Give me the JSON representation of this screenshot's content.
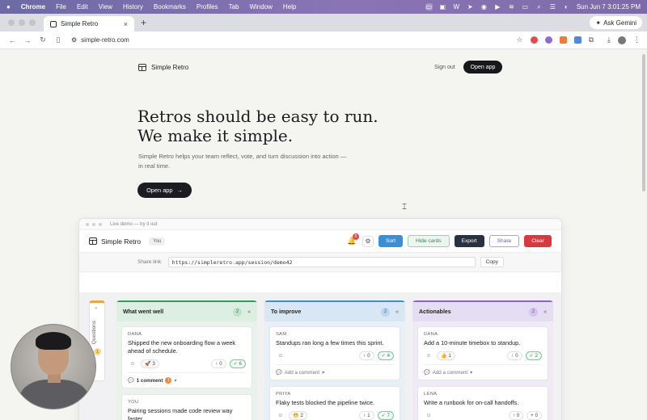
{
  "menubar": {
    "app": "Chrome",
    "items": [
      "File",
      "Edit",
      "View",
      "History",
      "Bookmarks",
      "Profiles",
      "Tab",
      "Window",
      "Help"
    ],
    "datetime": "Sun Jun 7  3:01:25 PM"
  },
  "browser": {
    "tab_title": "Simple Retro",
    "new_tab": "+",
    "gemini": "Ask Gemini",
    "url": "simple-retro.com"
  },
  "landing": {
    "brand": "Simple Retro",
    "sign_in": "Sign out",
    "open_app_top": "Open app",
    "hero_line1": "Retros should be easy to run.",
    "hero_line2": "We make it simple.",
    "subtitle": "Simple Retro helps your team reflect, vote, and turn discussion into action — in real time.",
    "cta": "Open app",
    "cta_arrow": "→"
  },
  "demo": {
    "window_label": "Live demo — try it out",
    "brand": "Simple Retro",
    "you": "You",
    "notif_count": "5",
    "buttons": {
      "sort": "Sort",
      "hide": "Hide cards",
      "export": "Export",
      "share": "Share",
      "clear": "Clear"
    },
    "share_label": "Share link:",
    "share_url": "https://simpleretro.app/session/demo42",
    "copy": "Copy",
    "questions_label": "Questions",
    "questions_count": "1",
    "columns": [
      {
        "title": "What went well",
        "count": "2",
        "cards": [
          {
            "author": "DANA",
            "text": "Shipped the new onboarding flow a week ahead of schedule.",
            "reaction": "🚀",
            "reaction_count": "3",
            "up": "0",
            "check": "6",
            "comments": "1 comment",
            "comments_badge": "1"
          },
          {
            "author": "YOU",
            "text": "Pairing sessions made code review way faster."
          }
        ]
      },
      {
        "title": "To improve",
        "count": "2",
        "cards": [
          {
            "author": "SAM",
            "text": "Standups ran long a few times this sprint.",
            "up": "0",
            "check": "4",
            "add_comment": "Add a comment"
          },
          {
            "author": "PRIYA",
            "text": "Flaky tests blocked the pipeline twice.",
            "reaction": "😬",
            "reaction_count": "2",
            "up": "1",
            "check": "7"
          }
        ]
      },
      {
        "title": "Actionables",
        "count": "2",
        "cards": [
          {
            "author": "DANA",
            "text": "Add a 10-minute timebox to standup.",
            "reaction": "👍",
            "reaction_count": "1",
            "up": "0",
            "check": "2",
            "add_comment": "Add a comment"
          },
          {
            "author": "LENA",
            "text": "Write a runbook for on-call handoffs.",
            "up": "0",
            "plus": "0"
          }
        ]
      }
    ]
  },
  "colors": {
    "well": "#2f9e5c",
    "improve": "#3c8fd6",
    "action": "#8a63d2"
  }
}
